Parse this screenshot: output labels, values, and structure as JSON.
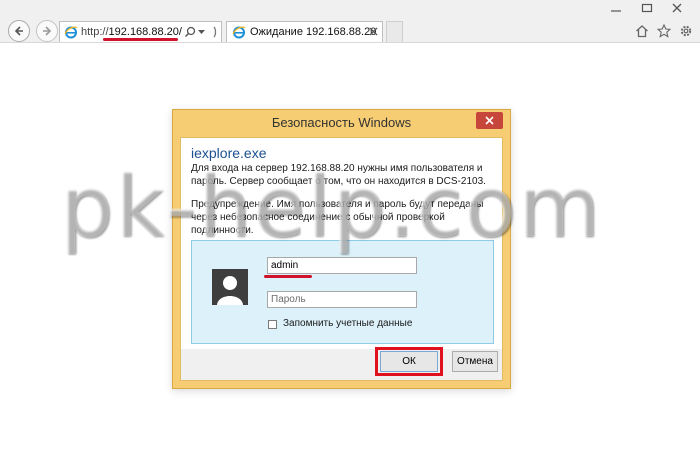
{
  "browser": {
    "address": {
      "protocol": "http://",
      "host": "192.168.88.20/"
    },
    "tab": {
      "title": "Ожидание 192.168.88.20"
    },
    "icons": [
      "back-icon",
      "forward-icon",
      "ie-icon",
      "search-icon",
      "chevron-down-icon",
      "refresh-icon",
      "close-icon",
      "home-icon",
      "star-icon",
      "gear-icon"
    ]
  },
  "dialog": {
    "title": "Безопасность Windows",
    "app_name": "iexplore.exe",
    "info": "Для входа на сервер 192.168.88.20 нужны имя пользователя и пароль. Сервер сообщает о том, что он находится в DCS-2103.",
    "warning": "Предупреждение. Имя пользователя и пароль будут переданы через небезопасное соединение с обычной проверкой подлинности.",
    "username_value": "admin",
    "password_placeholder": "Пароль",
    "remember_label": "Запомнить учетные данные",
    "ok_label": "ОК",
    "cancel_label": "Отмена"
  },
  "watermark": "pk-help.com",
  "colors": {
    "dialog_frame": "#f6cd72",
    "dialog_close": "#c7463b",
    "panel": "#dcf1fa",
    "highlight": "#e0101e",
    "link_blue": "#1d4f91"
  }
}
